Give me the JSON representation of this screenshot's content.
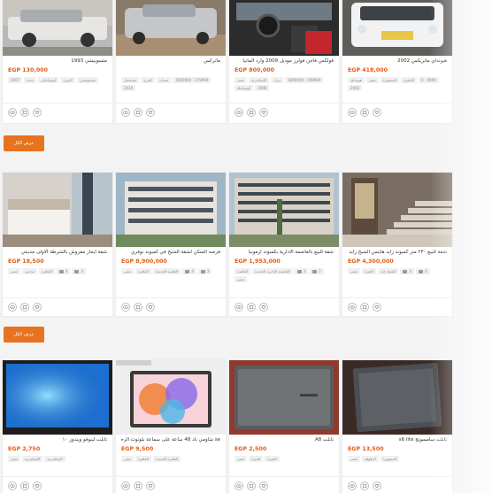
{
  "sections": [
    {
      "show_all_label": "عرض الكل",
      "cards": [
        {
          "title": "متسوبيشي 1993",
          "price": "EGP 130,000",
          "tags": [
            "متسوبيشي",
            "الجيزة",
            "أوتوماتيكي",
            "جديد",
            "2007"
          ],
          "image_icon": "car-photo"
        },
        {
          "title": "ماتركس",
          "price": "",
          "tags": [
            "1600000 - 179999",
            "سيدان",
            "المرج",
            "مستعمل",
            "2019"
          ],
          "image_icon": "car-photo"
        },
        {
          "title": "فولكس فاجن فولرز موديل 2009 وارد المانيا",
          "price": "EGP 800,000",
          "tags": [
            "1800000 - 199999",
            "ديزل",
            "الإسكندرية",
            "مصر",
            "2006",
            "أوتوماتيك"
          ],
          "image_icon": "car-interior-photo"
        },
        {
          "title": "هيونداي ماتريكس 2002",
          "price": "EGP 418,000",
          "tags": [
            "0 - 9999",
            "القاهرة",
            "المنصورة",
            "مصر",
            "هيونداي",
            "2002"
          ],
          "image_icon": "car-photo"
        }
      ]
    },
    {
      "show_all_label": "عرض الكل",
      "cards": [
        {
          "title": "شقة ايجار مفروش بالشرطة الاولى مدينتي",
          "price": "EGP 18,500",
          "tags": [
            "3",
            "4",
            "القاهرة",
            "مدينتي",
            "مصر"
          ],
          "image_icon": "bedroom-photo"
        },
        {
          "title": "فرصه السكن لشقة الشيخ في كمبوند نوفري",
          "price": "EGP 8,900,000",
          "tags": [
            "3",
            "4",
            "القاهرة الجديدة",
            "القاهرة",
            "مصر"
          ],
          "image_icon": "building-photo"
        },
        {
          "title": "شقة للبيع بالعاصمة الادارية بكمبوند ازمونيا",
          "price": "EGP 1,953,000",
          "tags": [
            "2",
            "3",
            "العاصمة الإدارية الجديدة",
            "القاهرة",
            "مصر"
          ],
          "image_icon": "building-photo"
        },
        {
          "title": "شقة للبيع ٢٣٠ متر كمبوند زايد هايتس الشيخ زايد",
          "price": "EGP 4,300,000",
          "tags": [
            "3",
            "4",
            "الشيخ زايد",
            "الجيزة",
            "مصر"
          ],
          "image_icon": "stairs-photo"
        }
      ]
    },
    {
      "show_all_label": "عرض الكل",
      "cards": [
        {
          "title": "تابلت لينوفو ويندوز ١٠",
          "price": "EGP 2,750",
          "tags": [
            "الإسكندرية",
            "الإسكندرية",
            "مصر"
          ],
          "image_icon": "tablet-photo"
        },
        {
          "title": "se شاومي باد 48 ساعة على سماعة بلوتوث الرحلة",
          "price": "EGP 9,500",
          "tags": [
            "القاهرة الجديدة",
            "القاهرة",
            "مصر"
          ],
          "image_icon": "tablet-box-photo"
        },
        {
          "title": "تابلت A8",
          "price": "EGP 2,500",
          "tags": [
            "الجيزة",
            "الجيزة",
            "مصر"
          ],
          "image_icon": "tablet-photo"
        },
        {
          "title": "تابلت سامسونج s6 lite",
          "price": "EGP 13,500",
          "tags": [
            "المنصورة",
            "الدقهلية",
            "مصر"
          ],
          "image_icon": "tablet-photo"
        }
      ]
    }
  ],
  "action_icons": [
    "eye-icon",
    "share-icon",
    "heart-icon"
  ]
}
